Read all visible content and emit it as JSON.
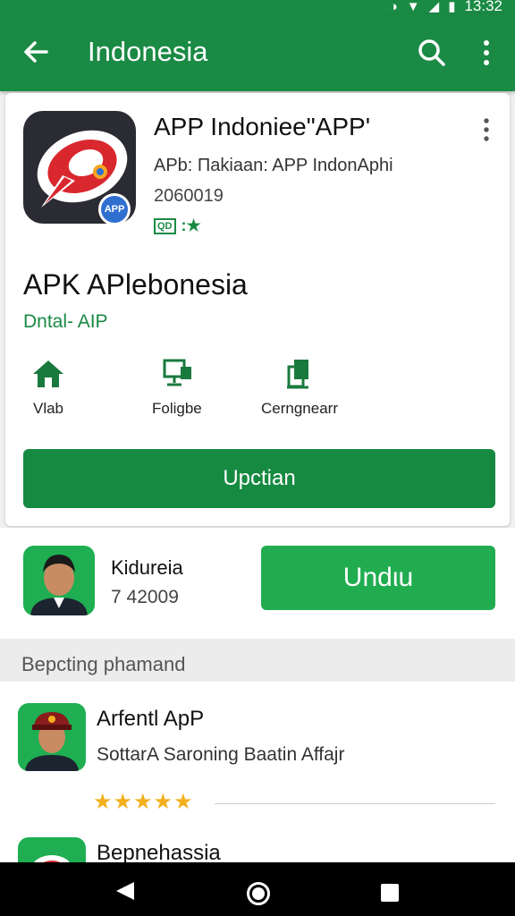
{
  "status": {
    "time": "13:32",
    "icons": [
      "vibrate-icon",
      "wifi-icon",
      "signal-icon",
      "battery-icon"
    ]
  },
  "appbar": {
    "title": "Indonesia"
  },
  "app": {
    "title": "APP Indoniee\"APP'",
    "subtitle": "APb: Пakiaan: APP IndonAphi",
    "date": "2060019",
    "rating_box": "QD",
    "rating_text": ":★",
    "big_title": "APK APlebonesia",
    "developer_link": "Dntal- AIP",
    "badge_text": "APP",
    "features": [
      {
        "label": "Vlab",
        "icon": "home-icon"
      },
      {
        "label": "Foligbe",
        "icon": "monitor-icon"
      },
      {
        "label": "Cerngnearr",
        "icon": "copy-icon"
      }
    ],
    "install_label": "Upctian"
  },
  "developer": {
    "name": "Kidureia",
    "number": "7 42009",
    "download_label": "Undιu"
  },
  "section": {
    "title": "Bepcting phamand"
  },
  "list": [
    {
      "title": "Arfentl ApP",
      "subtitle": "SottarA Saroning Baatin Affajr",
      "stars": "★★★★★"
    },
    {
      "title": "Bepnehassia"
    }
  ],
  "colors": {
    "primary": "#1a8a44",
    "button": "#168a41",
    "download": "#21ac50",
    "star": "#f2b01e"
  }
}
